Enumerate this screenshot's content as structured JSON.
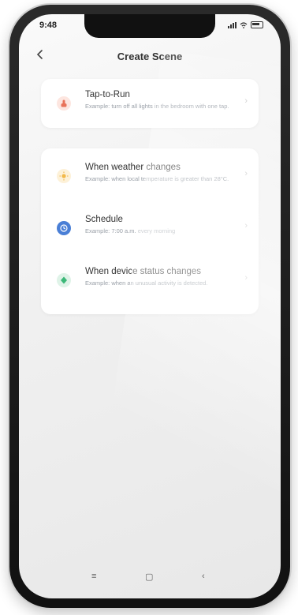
{
  "status": {
    "time": "9:48"
  },
  "header": {
    "back_icon": "chevron-left-icon",
    "title": "Create Scene"
  },
  "groups": [
    {
      "items": [
        {
          "title": "Tap-to-Run",
          "description": "Example: turn off all lights in the bedroom with one tap.",
          "icon": "hand-tap-icon",
          "color": "#e8735a"
        }
      ]
    },
    {
      "items": [
        {
          "title": "When weather changes",
          "description": "Example: when local temperature is greater than 28°C.",
          "icon": "sun-icon",
          "color": "#f2b94a"
        },
        {
          "title": "Schedule",
          "description": "Example: 7:00 a.m. every morning",
          "icon": "clock-icon",
          "color": "#4a7fd6"
        },
        {
          "title": "When device status changes",
          "description": "Example: when an unusual activity is detected.",
          "icon": "device-icon",
          "color": "#3cb878"
        }
      ]
    }
  ],
  "bottom_nav": {
    "menu_label": "≡",
    "home_label": "▢",
    "back_label": "‹"
  }
}
